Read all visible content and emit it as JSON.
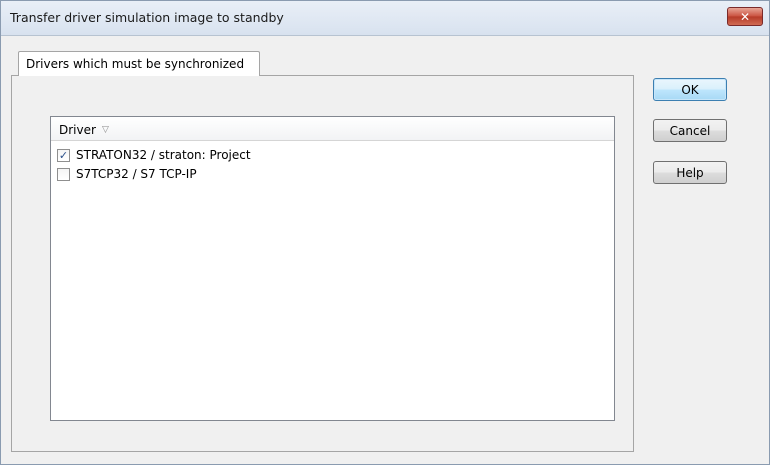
{
  "window": {
    "title": "Transfer driver simulation image to standby",
    "close_label": "✕"
  },
  "tabs": [
    {
      "label": "Drivers which must be synchronized",
      "active": true
    }
  ],
  "list": {
    "column_header": "Driver",
    "sort_icon": "sort-descending-icon",
    "sort_glyph": "▽",
    "rows": [
      {
        "label": "STRATON32 / straton: Project",
        "checked": true,
        "check_glyph": "✓"
      },
      {
        "label": "S7TCP32 / S7 TCP-IP",
        "checked": false,
        "check_glyph": ""
      }
    ]
  },
  "buttons": {
    "ok": "OK",
    "cancel": "Cancel",
    "help": "Help"
  },
  "colors": {
    "close_button": "#c9503e",
    "default_button_border": "#3c7fb1",
    "checkmark": "#2a4f8a"
  }
}
